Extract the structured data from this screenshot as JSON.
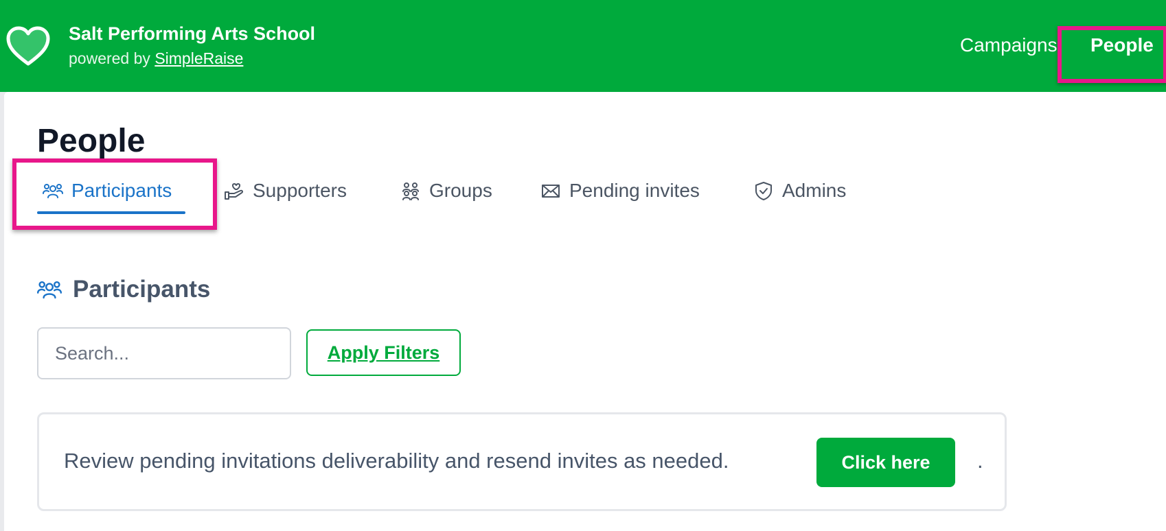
{
  "header": {
    "org_name": "Salt Performing Arts School",
    "powered_by_prefix": "powered by ",
    "powered_by_link": "SimpleRaise",
    "nav": [
      {
        "label": "Campaigns",
        "active": false
      },
      {
        "label": "People",
        "active": true
      }
    ],
    "logo_icon": "heart-icon"
  },
  "page": {
    "title": "People",
    "tabs": [
      {
        "label": "Participants",
        "icon": "participants-icon",
        "active": true
      },
      {
        "label": "Supporters",
        "icon": "hand-heart-icon",
        "active": false
      },
      {
        "label": "Groups",
        "icon": "groups-icon",
        "active": false
      },
      {
        "label": "Pending invites",
        "icon": "envelope-icon",
        "active": false
      },
      {
        "label": "Admins",
        "icon": "shield-check-icon",
        "active": false
      }
    ]
  },
  "section": {
    "title": "Participants",
    "icon": "participants-icon",
    "search_placeholder": "Search...",
    "apply_filters_label": "Apply Filters"
  },
  "notice": {
    "text": "Review pending invitations deliverability and resend invites as needed.",
    "button_label": "Click here",
    "trailing": "."
  },
  "colors": {
    "brand_green": "#00aa3c",
    "active_tab_blue": "#1a73c8",
    "highlight_pink": "#e8178a"
  }
}
